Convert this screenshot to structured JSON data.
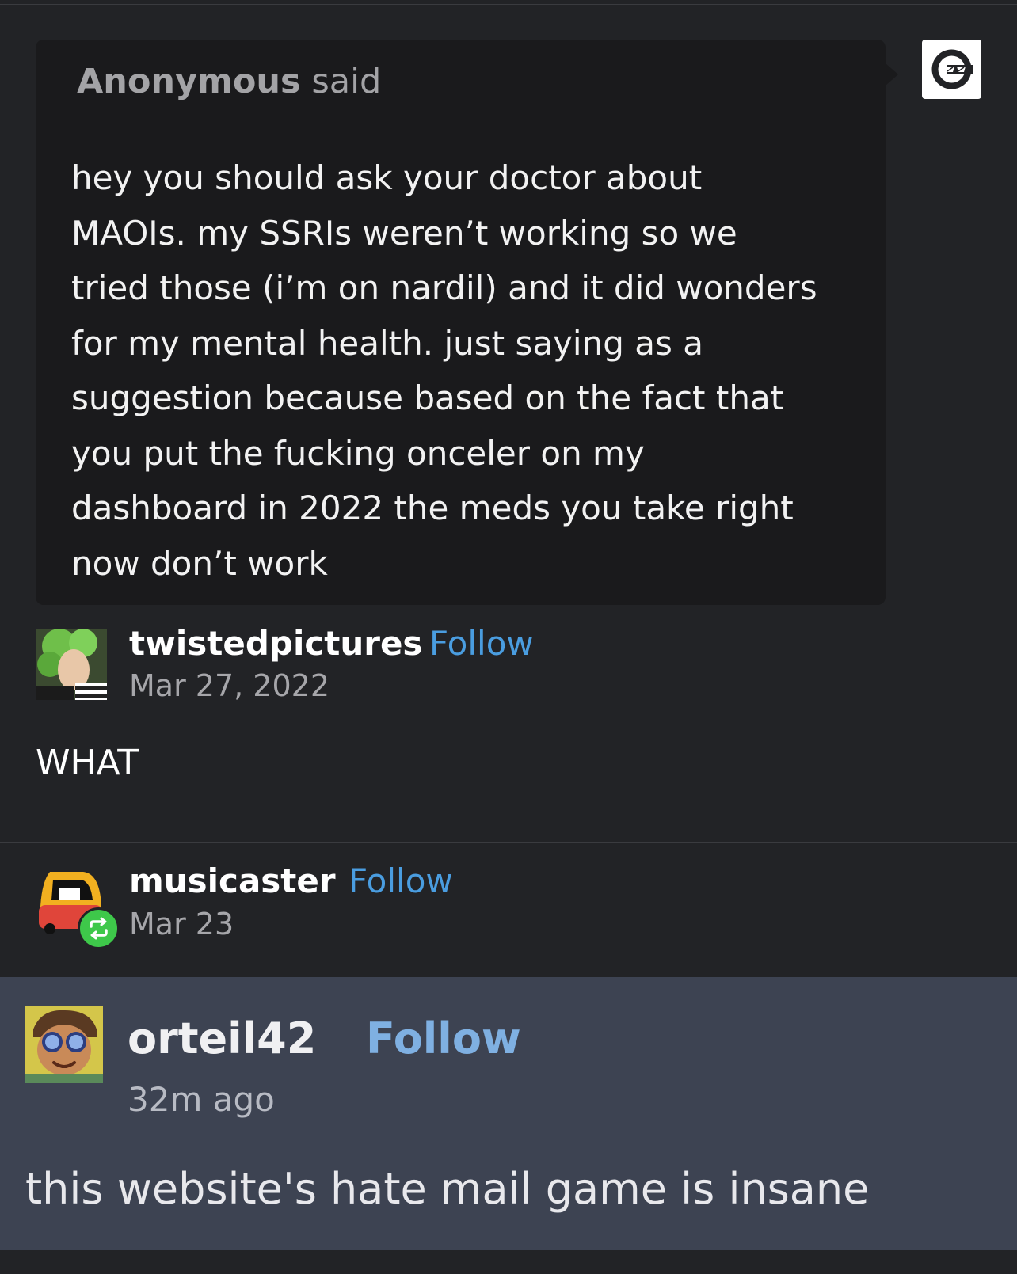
{
  "ask": {
    "asker": "Anonymous",
    "said": "said",
    "lines": [
      "hey you should ask your doctor about",
      "MAOIs. my SSRIs weren’t working so we",
      "tried those (i’m on nardil) and it did wonders",
      "for my mental health. just saying as a",
      "suggestion because based on the fact that",
      "you put the fucking onceler on my",
      "dashboard in 2022 the meds you take right",
      "now don’t work"
    ]
  },
  "answer": {
    "username": "twistedpictures",
    "follow_label": "Follow",
    "date": "Mar 27, 2022",
    "text": "WHAT"
  },
  "reblogger": {
    "username": "musicaster",
    "follow_label": "Follow",
    "date": "Mar 23"
  },
  "comment": {
    "username": "orteil42",
    "follow_label": "Follow",
    "time": "32m ago",
    "text": "this website's hate mail game is insane"
  },
  "colors": {
    "background": "#222326",
    "ask_bubble": "#1a1a1c",
    "follow_link": "#4a9de0",
    "reblog_badge": "#3ec84a",
    "overlay": "#3d4352"
  },
  "icons": [
    "anonymous-sunglasses-icon",
    "reblog-icon"
  ]
}
